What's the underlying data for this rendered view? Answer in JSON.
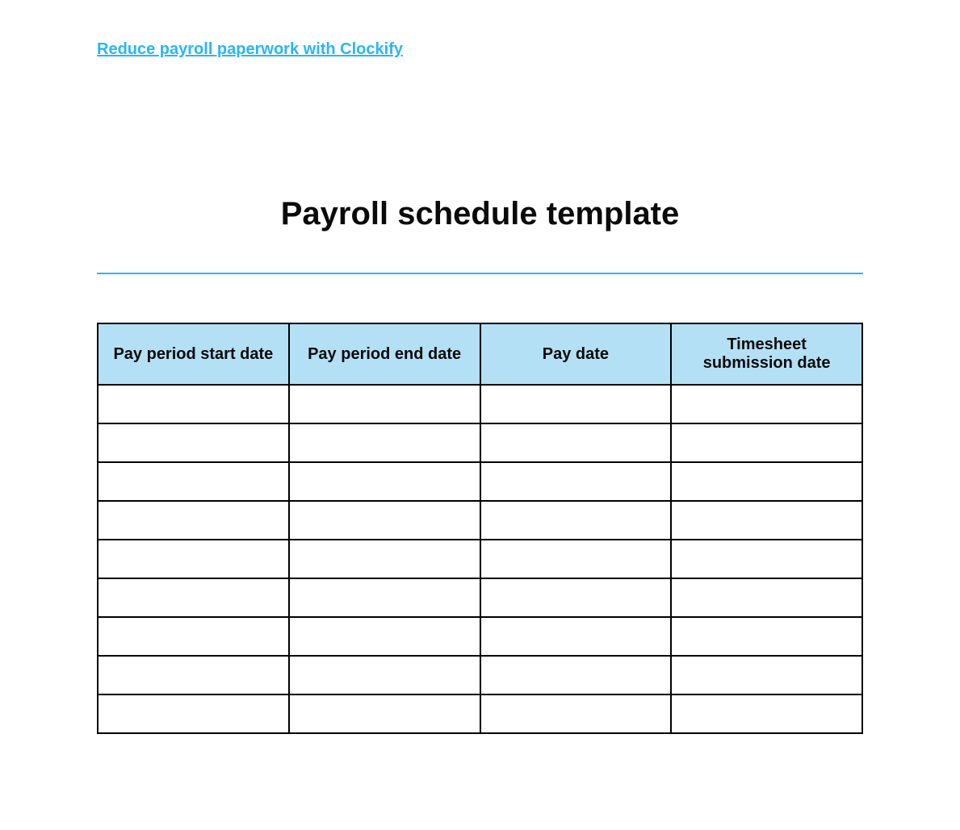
{
  "link_text": "Reduce payroll paperwork with Clockify",
  "title": "Payroll schedule template",
  "table": {
    "headers": [
      "Pay period start date",
      "Pay period end date",
      "Pay date",
      "Timesheet submission date"
    ],
    "rows": [
      [
        "",
        "",
        "",
        ""
      ],
      [
        "",
        "",
        "",
        ""
      ],
      [
        "",
        "",
        "",
        ""
      ],
      [
        "",
        "",
        "",
        ""
      ],
      [
        "",
        "",
        "",
        ""
      ],
      [
        "",
        "",
        "",
        ""
      ],
      [
        "",
        "",
        "",
        ""
      ],
      [
        "",
        "",
        "",
        ""
      ],
      [
        "",
        "",
        "",
        ""
      ]
    ]
  }
}
